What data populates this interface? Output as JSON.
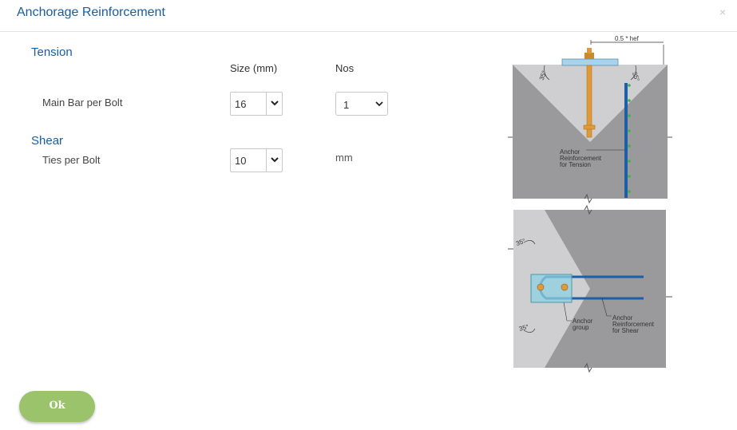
{
  "dialog": {
    "title": "Anchorage Reinforcement",
    "close_symbol": "×"
  },
  "tension": {
    "heading": "Tension",
    "size_header": "Size (mm)",
    "nos_header": "Nos",
    "main_bar_label": "Main Bar per Bolt",
    "main_bar_size": "16",
    "main_bar_nos": "1"
  },
  "shear": {
    "heading": "Shear",
    "ties_label": "Ties per Bolt",
    "ties_size": "10",
    "unit": "mm"
  },
  "diagram": {
    "dimension_label": "0.5 * hef",
    "angle_label": "35°",
    "tension_callout": [
      "Anchor",
      "Reinforcement",
      "for Tension"
    ],
    "anchor_group_callout": [
      "Anchor",
      "group"
    ],
    "shear_callout": [
      "Anchor",
      "Reinforcement",
      "for Shear"
    ]
  },
  "footer": {
    "ok_label": "Ok"
  },
  "colors": {
    "title_blue": "#1a5c9e",
    "ok_green": "#9bc36c",
    "concrete_gray": "#9a9a9c",
    "rebar_blue": "#1c5fa8",
    "anchor_orange": "#e09a3a"
  }
}
